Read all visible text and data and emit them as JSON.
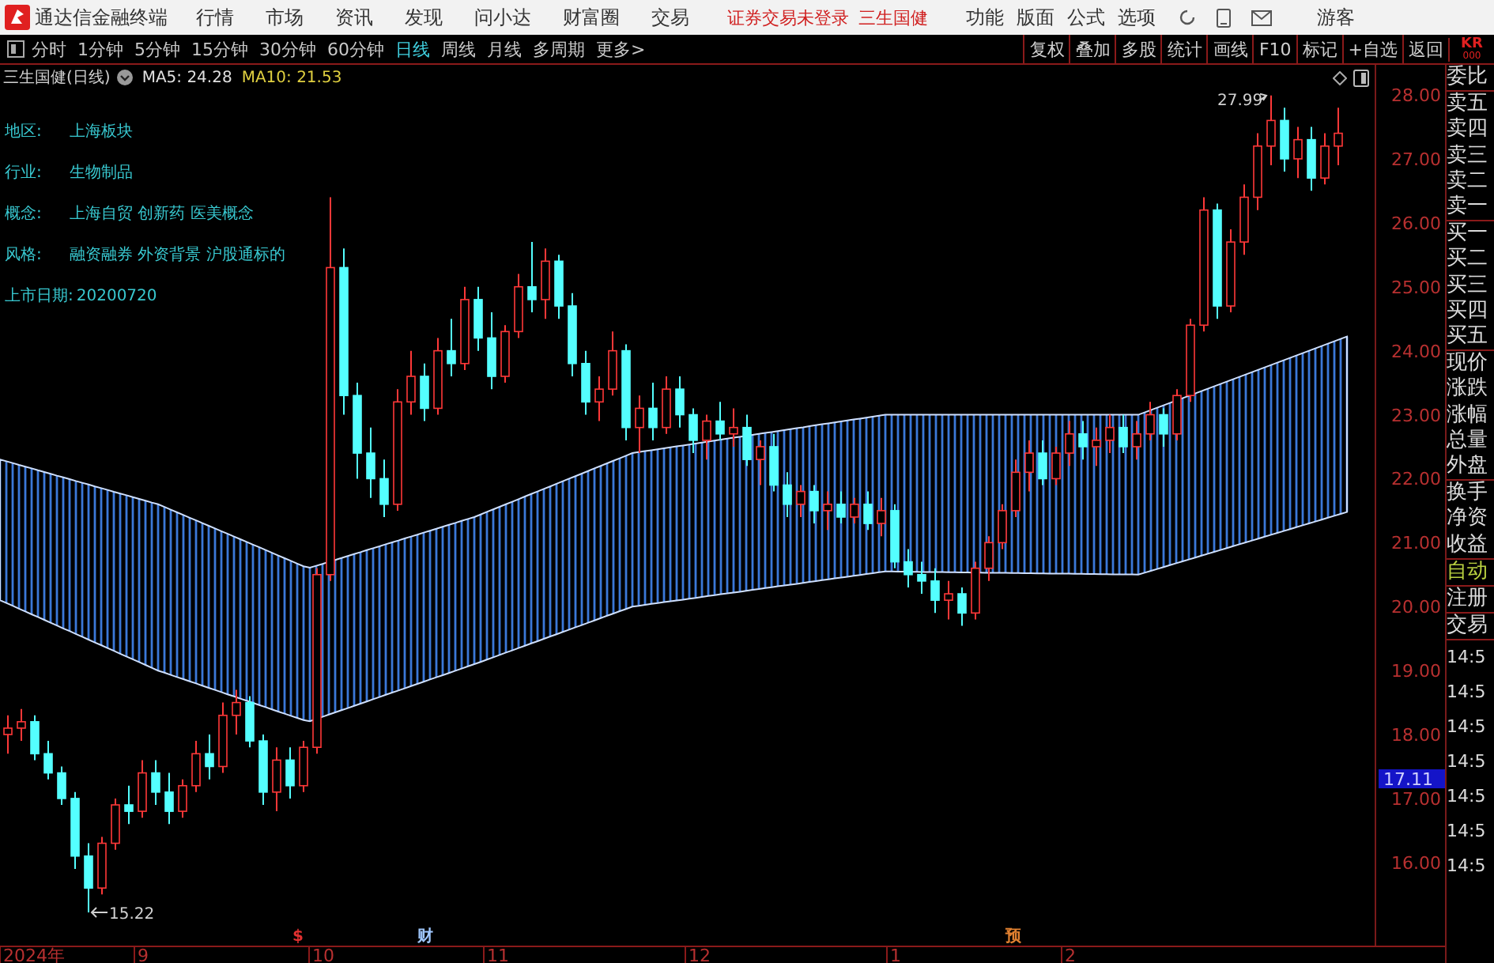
{
  "menu_bar": {
    "app_title": "通达信金融终端",
    "menus": [
      "行情",
      "市场",
      "资讯",
      "发现",
      "问小达",
      "财富圈",
      "交易"
    ],
    "status": "证券交易未登录",
    "stock": "三生国健",
    "right_menus": [
      "功能",
      "版面",
      "公式",
      "选项"
    ],
    "user": "游客"
  },
  "toolbar": {
    "periods": [
      {
        "label": "分时",
        "selected": false
      },
      {
        "label": "1分钟",
        "selected": false
      },
      {
        "label": "5分钟",
        "selected": false
      },
      {
        "label": "15分钟",
        "selected": false
      },
      {
        "label": "30分钟",
        "selected": false
      },
      {
        "label": "60分钟",
        "selected": false
      },
      {
        "label": "日线",
        "selected": true
      },
      {
        "label": "周线",
        "selected": false
      },
      {
        "label": "月线",
        "selected": false
      },
      {
        "label": "多周期",
        "selected": false
      },
      {
        "label": "更多>",
        "selected": false
      }
    ],
    "actions": [
      "复权",
      "叠加",
      "多股",
      "统计",
      "画线",
      "F10",
      "标记",
      "+自选",
      "返回"
    ],
    "corner": "KR",
    "corner_sub": "000"
  },
  "chart": {
    "title": "三生国健(日线)",
    "indicators": [
      {
        "label": "MA5: 24.28",
        "color": "#e0e0e0"
      },
      {
        "label": "MA10: 21.53",
        "color": "#e0d040"
      }
    ],
    "info": [
      {
        "label": "地区:",
        "value": "上海板块"
      },
      {
        "label": "行业:",
        "value": "生物制品"
      },
      {
        "label": "概念:",
        "value": "上海自贸 创新药 医美概念"
      },
      {
        "label": "风格:",
        "value": "融资融券 外资背景 沪股通标的"
      },
      {
        "label": "上市日期:",
        "value": "20200720"
      }
    ],
    "x_labels": [
      "2024年",
      "9",
      "10",
      "11",
      "12",
      "1",
      "2"
    ],
    "current_price": "17.11",
    "high_label": "27.99",
    "low_label": "15.22",
    "events": [
      {
        "label": "$",
        "color": "#e03030"
      },
      {
        "label": "财",
        "color": "#a0c8ff"
      },
      {
        "label": "预",
        "color": "#e08030"
      }
    ],
    "chart_data": {
      "type": "candlestick",
      "ylim": [
        14.7,
        28.47
      ],
      "yticks": [
        {
          "value": 28,
          "label": "28.00"
        },
        {
          "value": 27,
          "label": "27.00"
        },
        {
          "value": 26,
          "label": "26.00"
        },
        {
          "value": 25,
          "label": "25.00"
        },
        {
          "value": 24,
          "label": "24.00"
        },
        {
          "value": 23,
          "label": "23.00"
        },
        {
          "value": 22,
          "label": "22.00"
        },
        {
          "value": 21,
          "label": "21.00"
        },
        {
          "value": 20,
          "label": "20.00"
        },
        {
          "value": 19,
          "label": "19.00"
        },
        {
          "value": 18,
          "label": "18.00"
        },
        {
          "value": 17,
          "label": "17.00"
        },
        {
          "value": 16,
          "label": "16.00"
        }
      ],
      "ohlc": [
        [
          18.0,
          18.3,
          17.7,
          18.1
        ],
        [
          18.1,
          18.4,
          17.9,
          18.2
        ],
        [
          18.2,
          18.3,
          17.6,
          17.7
        ],
        [
          17.7,
          17.9,
          17.3,
          17.4
        ],
        [
          17.4,
          17.5,
          16.9,
          17.0
        ],
        [
          17.0,
          17.1,
          15.9,
          16.1
        ],
        [
          16.1,
          16.3,
          15.22,
          15.6
        ],
        [
          15.6,
          16.4,
          15.5,
          16.3
        ],
        [
          16.3,
          17.0,
          16.2,
          16.9
        ],
        [
          16.9,
          17.2,
          16.6,
          16.8
        ],
        [
          16.8,
          17.6,
          16.7,
          17.4
        ],
        [
          17.4,
          17.6,
          16.9,
          17.1
        ],
        [
          17.1,
          17.4,
          16.6,
          16.8
        ],
        [
          16.8,
          17.3,
          16.7,
          17.2
        ],
        [
          17.2,
          17.9,
          17.1,
          17.7
        ],
        [
          17.7,
          18.0,
          17.3,
          17.5
        ],
        [
          17.5,
          18.5,
          17.4,
          18.3
        ],
        [
          18.3,
          18.7,
          18.0,
          18.5
        ],
        [
          18.5,
          18.6,
          17.8,
          17.9
        ],
        [
          17.9,
          18.0,
          16.9,
          17.1
        ],
        [
          17.1,
          17.8,
          16.8,
          17.6
        ],
        [
          17.6,
          17.8,
          17.0,
          17.2
        ],
        [
          17.2,
          17.9,
          17.1,
          17.8
        ],
        [
          17.8,
          20.6,
          17.7,
          20.5
        ],
        [
          20.5,
          26.4,
          20.4,
          25.3
        ],
        [
          25.3,
          25.6,
          23.0,
          23.3
        ],
        [
          23.3,
          23.5,
          22.0,
          22.4
        ],
        [
          22.4,
          22.8,
          21.7,
          22.0
        ],
        [
          22.0,
          22.3,
          21.4,
          21.6
        ],
        [
          21.6,
          23.4,
          21.5,
          23.2
        ],
        [
          23.2,
          24.0,
          23.0,
          23.6
        ],
        [
          23.6,
          23.8,
          22.9,
          23.1
        ],
        [
          23.1,
          24.2,
          23.0,
          24.0
        ],
        [
          24.0,
          24.5,
          23.6,
          23.8
        ],
        [
          23.8,
          25.0,
          23.7,
          24.8
        ],
        [
          24.8,
          25.0,
          24.0,
          24.2
        ],
        [
          24.2,
          24.6,
          23.4,
          23.6
        ],
        [
          23.6,
          24.4,
          23.5,
          24.3
        ],
        [
          24.3,
          25.2,
          24.2,
          25.0
        ],
        [
          25.0,
          25.7,
          24.6,
          24.8
        ],
        [
          24.8,
          25.6,
          24.5,
          25.4
        ],
        [
          25.4,
          25.5,
          24.5,
          24.7
        ],
        [
          24.7,
          24.9,
          23.6,
          23.8
        ],
        [
          23.8,
          24.0,
          23.0,
          23.2
        ],
        [
          23.2,
          23.6,
          22.9,
          23.4
        ],
        [
          23.4,
          24.3,
          23.3,
          24.0
        ],
        [
          24.0,
          24.1,
          22.6,
          22.8
        ],
        [
          22.8,
          23.3,
          22.4,
          23.1
        ],
        [
          23.1,
          23.5,
          22.6,
          22.8
        ],
        [
          22.8,
          23.6,
          22.7,
          23.4
        ],
        [
          23.4,
          23.6,
          22.8,
          23.0
        ],
        [
          23.0,
          23.1,
          22.4,
          22.6
        ],
        [
          22.6,
          23.0,
          22.3,
          22.9
        ],
        [
          22.9,
          23.2,
          22.6,
          22.7
        ],
        [
          22.7,
          23.1,
          22.5,
          22.8
        ],
        [
          22.8,
          23.0,
          22.2,
          22.3
        ],
        [
          22.3,
          22.6,
          21.9,
          22.5
        ],
        [
          22.5,
          22.7,
          21.8,
          21.9
        ],
        [
          21.9,
          22.1,
          21.4,
          21.6
        ],
        [
          21.6,
          21.9,
          21.4,
          21.8
        ],
        [
          21.8,
          21.9,
          21.3,
          21.5
        ],
        [
          21.5,
          21.8,
          21.2,
          21.6
        ],
        [
          21.6,
          21.8,
          21.3,
          21.4
        ],
        [
          21.4,
          21.7,
          21.3,
          21.6
        ],
        [
          21.6,
          21.8,
          21.2,
          21.3
        ],
        [
          21.3,
          21.7,
          21.1,
          21.5
        ],
        [
          21.5,
          21.6,
          20.6,
          20.7
        ],
        [
          20.7,
          20.9,
          20.3,
          20.5
        ],
        [
          20.5,
          20.7,
          20.2,
          20.4
        ],
        [
          20.4,
          20.6,
          19.9,
          20.1
        ],
        [
          20.1,
          20.4,
          19.8,
          20.2
        ],
        [
          20.2,
          20.3,
          19.7,
          19.9
        ],
        [
          19.9,
          20.7,
          19.8,
          20.6
        ],
        [
          20.6,
          21.1,
          20.4,
          21.0
        ],
        [
          21.0,
          21.6,
          20.9,
          21.5
        ],
        [
          21.5,
          22.3,
          21.4,
          22.1
        ],
        [
          22.1,
          22.6,
          21.8,
          22.4
        ],
        [
          22.4,
          22.6,
          21.9,
          22.0
        ],
        [
          22.0,
          22.5,
          21.9,
          22.4
        ],
        [
          22.4,
          22.9,
          22.2,
          22.7
        ],
        [
          22.7,
          22.9,
          22.3,
          22.5
        ],
        [
          22.5,
          22.8,
          22.2,
          22.6
        ],
        [
          22.6,
          23.0,
          22.4,
          22.8
        ],
        [
          22.8,
          23.0,
          22.4,
          22.5
        ],
        [
          22.5,
          22.9,
          22.3,
          22.7
        ],
        [
          22.7,
          23.2,
          22.6,
          23.0
        ],
        [
          23.0,
          23.1,
          22.5,
          22.7
        ],
        [
          22.7,
          23.4,
          22.6,
          23.3
        ],
        [
          23.3,
          24.5,
          23.2,
          24.4
        ],
        [
          24.4,
          26.4,
          24.3,
          26.2
        ],
        [
          26.2,
          26.3,
          24.5,
          24.7
        ],
        [
          24.7,
          25.9,
          24.6,
          25.7
        ],
        [
          25.7,
          26.6,
          25.5,
          26.4
        ],
        [
          26.4,
          27.4,
          26.2,
          27.2
        ],
        [
          27.2,
          27.99,
          26.9,
          27.6
        ],
        [
          27.6,
          27.8,
          26.8,
          27.0
        ],
        [
          27.0,
          27.5,
          26.7,
          27.3
        ],
        [
          27.3,
          27.5,
          26.5,
          26.7
        ],
        [
          26.7,
          27.4,
          26.6,
          27.2
        ],
        [
          27.2,
          27.8,
          26.9,
          27.4
        ]
      ]
    }
  },
  "quote_panel": {
    "groups": [
      [
        "委比"
      ],
      [
        "卖五",
        "卖四",
        "卖三",
        "卖二",
        "卖一"
      ],
      [
        "买一",
        "买二",
        "买三",
        "买四",
        "买五"
      ],
      [
        "现价",
        "涨跌",
        "涨幅",
        "总量",
        "外盘"
      ],
      [
        "换手",
        "净资",
        "收益"
      ]
    ],
    "auto": "自动",
    "links": [
      "注册",
      "交易"
    ],
    "times": [
      "14:5",
      "14:5",
      "14:5",
      "14:5",
      "14:5",
      "14:5",
      "14:5"
    ]
  }
}
